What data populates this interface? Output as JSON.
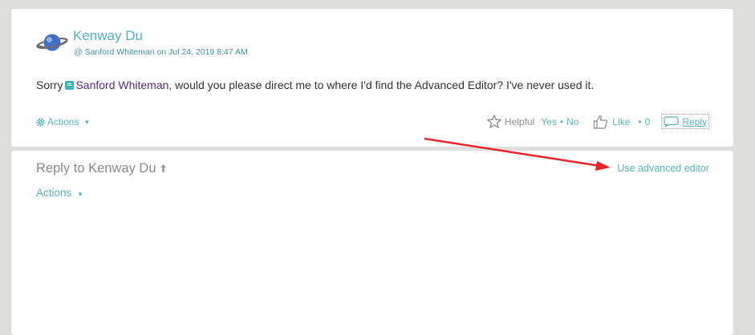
{
  "post": {
    "author": "Kenway Du",
    "meta": "@ Sanford Whiteman on Jul 24, 2019 8:47 AM",
    "body_prefix": "Sorry",
    "mention": "Sanford Whiteman",
    "body_suffix": ", would you please direct me to where I'd find the Advanced Editor? I've never used it.",
    "actions_label": "Actions",
    "helpful_label": "Helpful",
    "yes_label": "Yes",
    "separator": "•",
    "no_label": "No",
    "like_label": "Like",
    "like_count": "0",
    "reply_label": "Reply"
  },
  "reply_box": {
    "title": "Reply to Kenway Du",
    "actions_label": "Actions",
    "advanced_editor_label": "Use advanced editor"
  },
  "colors": {
    "accent": "#56b4c1",
    "mention": "#5a2a82",
    "annotation_arrow": "#e8262a"
  }
}
